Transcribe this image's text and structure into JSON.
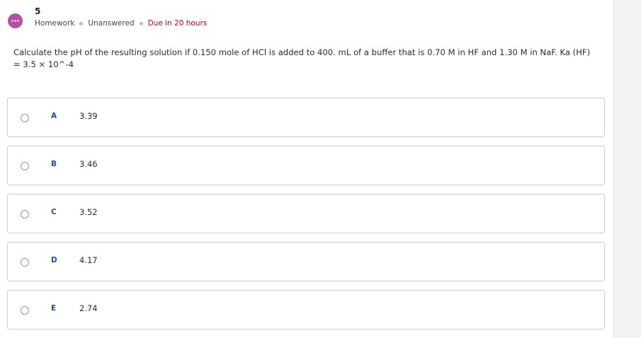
{
  "question": {
    "number": "5",
    "meta": {
      "type": "Homework",
      "status": "Unanswered",
      "due": "Due in 20 hours"
    },
    "text": "Calculate the pH of the resulting solution if 0.150 mole of HCl is added to 400. mL of a buffer that is 0.70 M in HF and 1.30 M in NaF. Ka (HF) = 3.5 × 10^-4"
  },
  "choices": [
    {
      "letter": "A",
      "value": "3.39"
    },
    {
      "letter": "B",
      "value": "3.46"
    },
    {
      "letter": "C",
      "value": "3.52"
    },
    {
      "letter": "D",
      "value": "4.17"
    },
    {
      "letter": "E",
      "value": "2.74"
    }
  ],
  "colors": {
    "icon": "#b54f9f",
    "due": "#c4001a",
    "letter": "#1f4ea8"
  }
}
